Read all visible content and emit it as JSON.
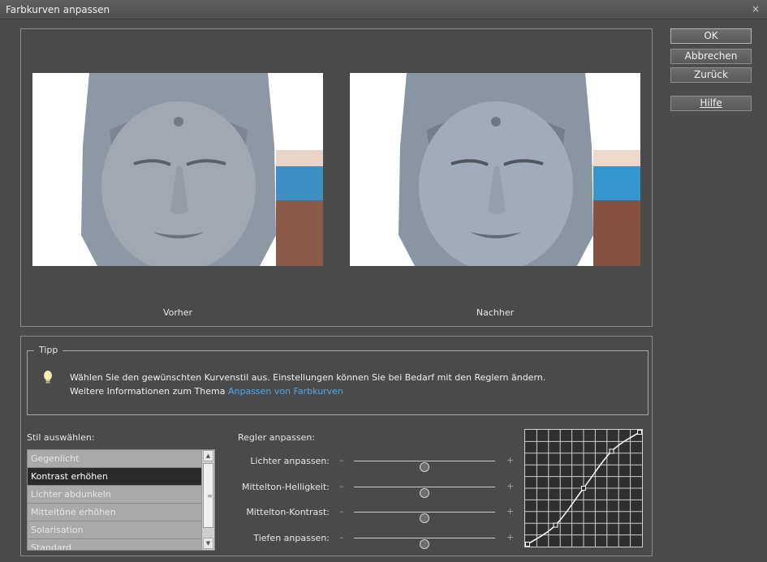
{
  "window": {
    "title": "Farbkurven anpassen",
    "close_symbol": "×"
  },
  "preview": {
    "before_caption": "Vorher",
    "after_caption": "Nachher"
  },
  "buttons": {
    "ok": "OK",
    "cancel": "Abbrechen",
    "reset": "Zurück",
    "help": "Hilfe"
  },
  "tip": {
    "legend": "Tipp",
    "line1": "Wählen Sie den gewünschten Kurvenstil aus. Einstellungen können Sie bei Bedarf mit den Reglern ändern.",
    "line2_prefix": "Weitere Informationen zum Thema ",
    "link": "Anpassen von Farbkurven"
  },
  "style": {
    "label": "Stil auswählen:",
    "items": [
      "Gegenlicht",
      "Kontrast erhöhen",
      "Lichter abdunkeln",
      "Mitteltöne erhöhen",
      "Solarisation",
      "Standard"
    ],
    "selected": "Kontrast erhöhen"
  },
  "sliders": {
    "label": "Regler anpassen:",
    "minus": "–",
    "plus": "+",
    "items": [
      {
        "label": "Lichter anpassen:",
        "value": 0.5
      },
      {
        "label": "Mittelton-Helligkeit:",
        "value": 0.5
      },
      {
        "label": "Mittelton-Kontrast:",
        "value": 0.5
      },
      {
        "label": "Tiefen anpassen:",
        "value": 0.5
      }
    ]
  },
  "curve": {
    "control_points": [
      [
        0,
        0
      ],
      [
        0.25,
        0.17
      ],
      [
        0.5,
        0.5
      ],
      [
        0.75,
        0.83
      ],
      [
        1,
        1
      ]
    ]
  },
  "colors": {
    "link": "#53a8ea",
    "selected_item": "#2b2b2b",
    "bulb": "#f4ecb0"
  },
  "icons": [
    "close-icon",
    "lightbulb-icon",
    "scroll-up-icon",
    "scroll-down-icon"
  ]
}
